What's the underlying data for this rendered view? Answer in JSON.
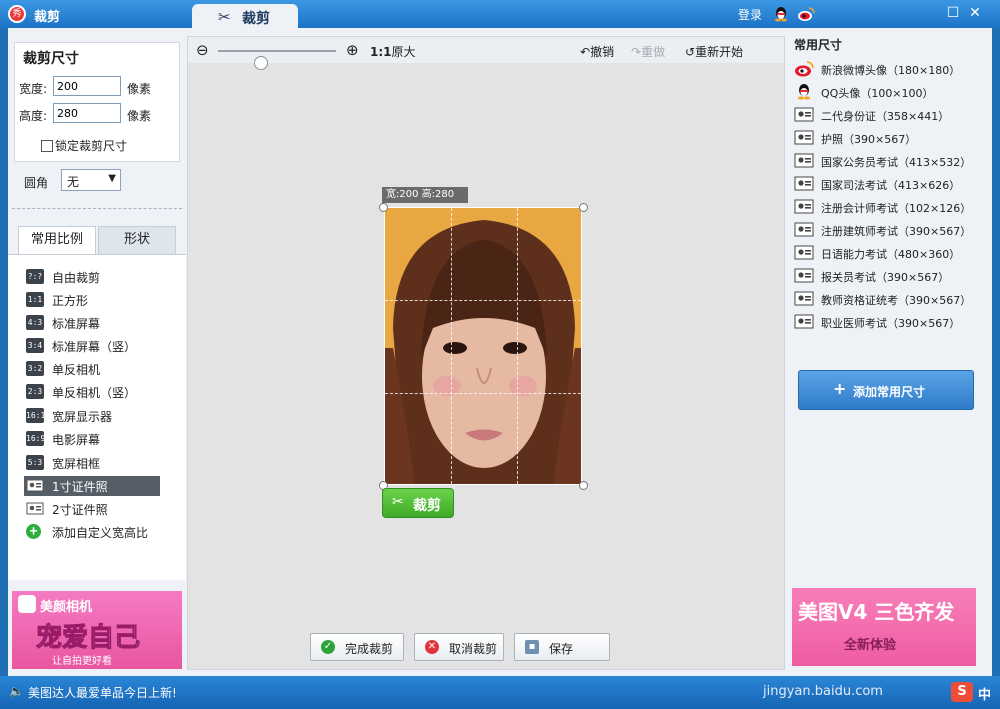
{
  "window": {
    "app_icon_text": "秀",
    "title": "裁剪",
    "active_tab": "裁剪",
    "login": "登录"
  },
  "crop_size": {
    "title": "裁剪尺寸",
    "width_label": "宽度:",
    "width_value": "200",
    "height_label": "高度:",
    "height_value": "280",
    "unit": "像素",
    "lock_label": "锁定裁剪尺寸",
    "corner_label": "圆角",
    "corner_value": "无"
  },
  "left_tabs": [
    "常用比例",
    "形状"
  ],
  "ratio_items": [
    {
      "icon": "?:?",
      "label": "自由裁剪"
    },
    {
      "icon": "1:1",
      "label": "正方形"
    },
    {
      "icon": "4:3",
      "label": "标准屏幕"
    },
    {
      "icon": "3:4",
      "label": "标准屏幕（竖）"
    },
    {
      "icon": "3:2",
      "label": "单反相机"
    },
    {
      "icon": "2:3",
      "label": "单反相机（竖）"
    },
    {
      "icon": "16:10",
      "label": "宽屏显示器"
    },
    {
      "icon": "16:9",
      "label": "电影屏幕"
    },
    {
      "icon": "5:3",
      "label": "宽屏相框"
    },
    {
      "icon": "",
      "label": "1寸证件照"
    },
    {
      "icon": "",
      "label": "2寸证件照"
    },
    {
      "icon": "+",
      "label": "添加自定义宽高比"
    }
  ],
  "ad_left": {
    "brand": "美颜相机",
    "slogan": "宠爱自己",
    "sub": "让自拍更好看"
  },
  "toolbar": {
    "zoom_ratio": "1:1",
    "original_size": "原大",
    "undo": "撤销",
    "redo": "重做",
    "restart": "重新开始",
    "zoom_level": 0.35
  },
  "canvas": {
    "size_tag": "宽:200 高:280",
    "crop_button": "裁剪"
  },
  "bottom_buttons": {
    "done": "完成裁剪",
    "cancel": "取消裁剪",
    "save": "保存"
  },
  "presets": {
    "title": "常用尺寸",
    "items": [
      {
        "icon": "weibo-icon",
        "label": "新浪微博头像（180×180）"
      },
      {
        "icon": "qq-icon",
        "label": "QQ头像（100×100）"
      },
      {
        "icon": "id-card-icon",
        "label": "二代身份证（358×441）"
      },
      {
        "icon": "id-card-icon",
        "label": "护照（390×567）"
      },
      {
        "icon": "id-card-icon",
        "label": "国家公务员考试（413×532）"
      },
      {
        "icon": "id-card-icon",
        "label": "国家司法考试（413×626）"
      },
      {
        "icon": "id-card-icon",
        "label": "注册会计师考试（102×126）"
      },
      {
        "icon": "id-card-icon",
        "label": "注册建筑师考试（390×567）"
      },
      {
        "icon": "id-card-icon",
        "label": "日语能力考试（480×360）"
      },
      {
        "icon": "id-card-icon",
        "label": "报关员考试（390×567）"
      },
      {
        "icon": "id-card-icon",
        "label": "教师资格证统考（390×567）"
      },
      {
        "icon": "id-card-icon",
        "label": "职业医师考试（390×567）"
      }
    ],
    "add_button": "添加常用尺寸"
  },
  "ad_right": {
    "headline": "美图V4 三色齐发",
    "sub": "全新体验"
  },
  "status": {
    "text": "美图达人最爱单品今日上新!",
    "watermark": "jingyan.baidu.com",
    "ime_logo": "S",
    "ime_mode": "中"
  },
  "colors": {
    "titlebar": "#1c73c6",
    "accent_green": "#3faa28",
    "accent_blue": "#2f7cc9",
    "selected_item": "#555d66"
  }
}
